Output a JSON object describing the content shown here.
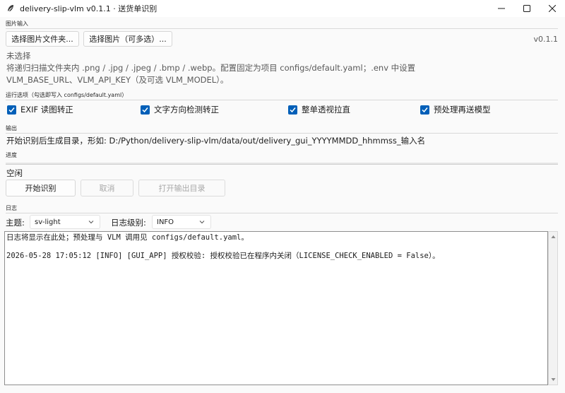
{
  "window": {
    "title": "delivery-slip-vlm v0.1.1 · 送货单识别",
    "icons": {
      "app": "feather-icon",
      "minimize": "minimize-icon",
      "maximize": "maximize-icon",
      "close": "close-icon"
    }
  },
  "image_input": {
    "group_label": "图片输入",
    "folder_button": "选择图片文件夹...",
    "files_button": "选择图片（可多选）...",
    "version": "v0.1.1",
    "selection_status": "未选择",
    "hint_line1": "将递归扫描文件夹内 .png / .jpg / .jpeg / .bmp / .webp。配置固定为项目 configs/default.yaml；.env 中设置",
    "hint_line2": "VLM_BASE_URL、VLM_API_KEY（及可选 VLM_MODEL）。"
  },
  "options": {
    "group_label": "运行选项（勾选即写入 configs/default.yaml）",
    "items": [
      {
        "label": "EXIF 读图转正",
        "checked": true
      },
      {
        "label": "文字方向检测转正",
        "checked": true
      },
      {
        "label": "整单透视拉直",
        "checked": true
      },
      {
        "label": "预处理再送模型",
        "checked": true
      }
    ]
  },
  "output": {
    "group_label": "输出",
    "description": "开始识别后生成目录，形如: D:/Python/delivery-slip-vlm/data/out/delivery_gui_YYYYMMDD_hhmmss_输入名"
  },
  "progress": {
    "group_label": "进度",
    "value": 0,
    "status": "空闲",
    "start_button": "开始识别",
    "cancel_button": "取消",
    "open_output_button": "打开输出目录"
  },
  "log": {
    "group_label": "日志",
    "theme_label": "主题:",
    "theme_value": "sv-light",
    "level_label": "日志级别:",
    "level_value": "INFO",
    "lines": [
      "日志将显示在此处；预处理与 VLM 调用见 configs/default.yaml。",
      "",
      "2026-05-28 17:05:12 [INFO] [GUI_APP] 授权校验: 授权校验已在程序内关闭（LICENSE_CHECK_ENABLED = False）。"
    ]
  },
  "colors": {
    "accent": "#005fb8",
    "background": "#fafafa",
    "titlebar": "#ffffff"
  }
}
